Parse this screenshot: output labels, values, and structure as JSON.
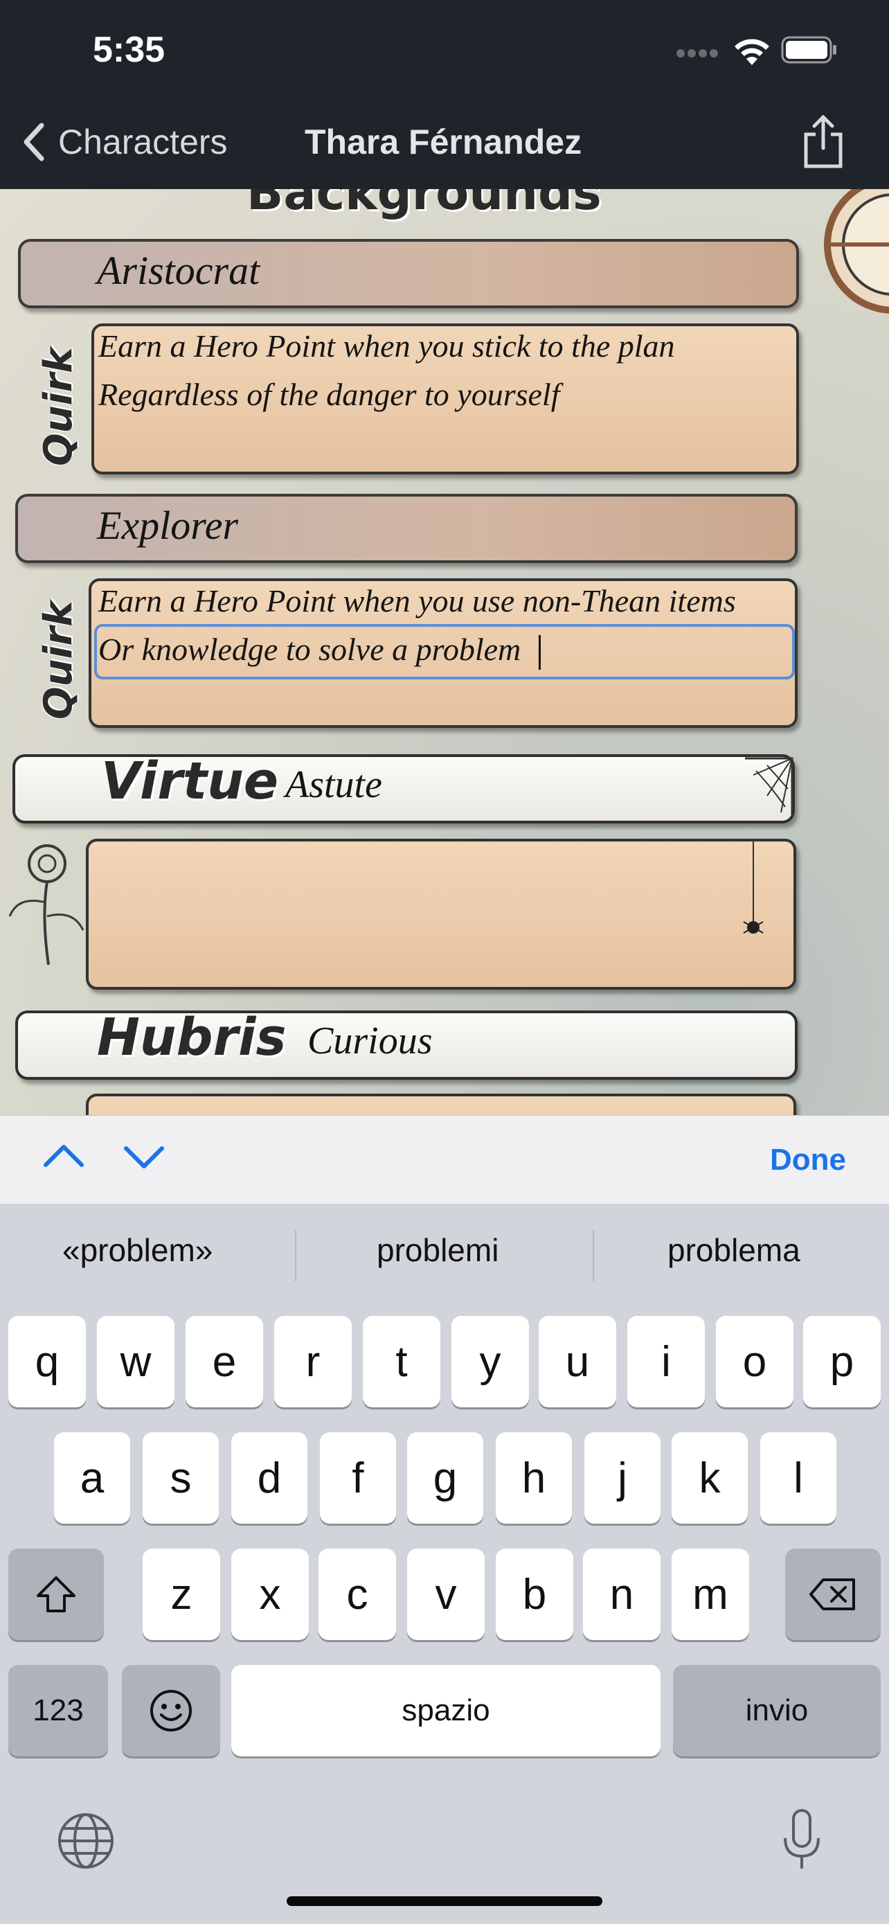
{
  "status_bar": {
    "time": "5:35"
  },
  "nav": {
    "back_label": "Characters",
    "title": "Thara Férnandez"
  },
  "sheet": {
    "section_heading": "Backgrounds",
    "backgrounds": [
      {
        "name": "Aristocrat",
        "quirk_label": "Quirk",
        "quirk_lines": [
          "Earn a Hero Point when you stick to the plan",
          "Regardless of the danger to yourself"
        ]
      },
      {
        "name": "Explorer",
        "quirk_label": "Quirk",
        "quirk_lines": [
          "Earn a Hero Point when you use non-Thean items",
          "Or knowledge to solve a problem"
        ]
      }
    ],
    "virtue": {
      "label": "Virtue",
      "value": "Astute"
    },
    "hubris": {
      "label": "Hubris",
      "value": "Curious"
    }
  },
  "accessory_bar": {
    "done_label": "Done"
  },
  "keyboard": {
    "suggestions": [
      "«problem»",
      "problemi",
      "problema"
    ],
    "row1": [
      "q",
      "w",
      "e",
      "r",
      "t",
      "y",
      "u",
      "i",
      "o",
      "p"
    ],
    "row2": [
      "a",
      "s",
      "d",
      "f",
      "g",
      "h",
      "j",
      "k",
      "l"
    ],
    "row3": [
      "z",
      "x",
      "c",
      "v",
      "b",
      "n",
      "m"
    ],
    "numbers_label": "123",
    "space_label": "spazio",
    "return_label": "invio"
  },
  "colors": {
    "focus_outline": "#5b8fd6",
    "accent": "#1a73e8",
    "nav_bg": "#1f232a"
  }
}
